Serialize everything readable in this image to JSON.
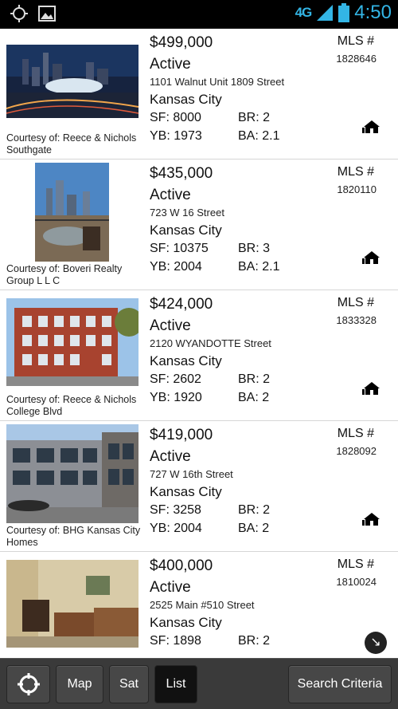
{
  "status_bar": {
    "network": "4G",
    "time": "4:50"
  },
  "listings": [
    {
      "price": "$499,000",
      "status": "Active",
      "address": "1101 Walnut Unit 1809 Street",
      "city": "Kansas City",
      "sf": "SF: 8000",
      "br": "BR: 2",
      "yb": "YB: 1973",
      "ba": "BA: 2.1",
      "mls_label": "MLS #",
      "mls": "1828646",
      "courtesy": "Courtesy of: Reece & Nichols Southgate"
    },
    {
      "price": "$435,000",
      "status": "Active",
      "address": "723 W 16 Street",
      "city": "Kansas City",
      "sf": "SF: 10375",
      "br": "BR: 3",
      "yb": "YB: 2004",
      "ba": "BA: 2.1",
      "mls_label": "MLS #",
      "mls": "1820110",
      "courtesy": "Courtesy of: Boveri Realty Group L L C"
    },
    {
      "price": "$424,000",
      "status": "Active",
      "address": "2120 WYANDOTTE Street",
      "city": "Kansas City",
      "sf": "SF: 2602",
      "br": "BR: 2",
      "yb": "YB: 1920",
      "ba": "BA: 2",
      "mls_label": "MLS #",
      "mls": "1833328",
      "courtesy": "Courtesy of: Reece & Nichols College Blvd"
    },
    {
      "price": "$419,000",
      "status": "Active",
      "address": "727 W 16th Street",
      "city": "Kansas City",
      "sf": "SF: 3258",
      "br": "BR: 2",
      "yb": "YB: 2004",
      "ba": "BA: 2",
      "mls_label": "MLS #",
      "mls": "1828092",
      "courtesy": "Courtesy of: BHG Kansas City Homes"
    },
    {
      "price": "$400,000",
      "status": "Active",
      "address": "2525 Main #510 Street",
      "city": "Kansas City",
      "sf": "SF: 1898",
      "br": "BR: 2",
      "mls_label": "MLS #",
      "mls": "1810024"
    }
  ],
  "toolbar": {
    "map": "Map",
    "sat": "Sat",
    "list": "List",
    "search": "Search Criteria",
    "selected": "List"
  }
}
